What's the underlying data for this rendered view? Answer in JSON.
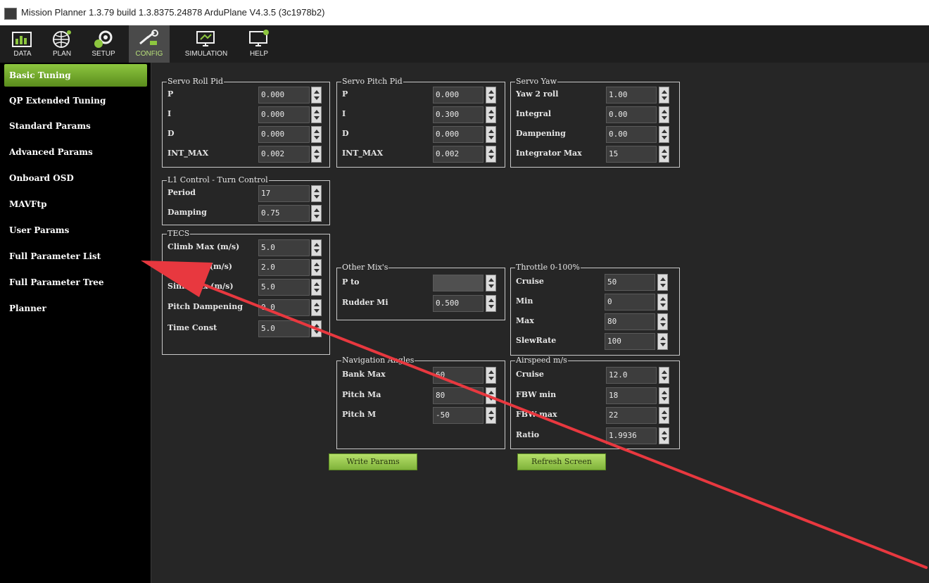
{
  "window": {
    "title": "Mission Planner 1.3.79 build 1.3.8375.24878 ArduPlane V4.3.5 (3c1978b2)"
  },
  "toolbar": [
    {
      "label": "DATA",
      "icon": "data-icon"
    },
    {
      "label": "PLAN",
      "icon": "plan-icon"
    },
    {
      "label": "SETUP",
      "icon": "setup-icon"
    },
    {
      "label": "CONFIG",
      "icon": "config-icon",
      "active": true
    },
    {
      "label": "SIMULATION",
      "icon": "simulation-icon"
    },
    {
      "label": "HELP",
      "icon": "help-icon"
    }
  ],
  "sidebar": [
    {
      "label": "Basic Tuning",
      "active": true
    },
    {
      "label": "QP Extended Tuning"
    },
    {
      "label": "Standard Params"
    },
    {
      "label": "Advanced Params"
    },
    {
      "label": "Onboard OSD"
    },
    {
      "label": "MAVFtp"
    },
    {
      "label": "User Params"
    },
    {
      "label": "Full Parameter List"
    },
    {
      "label": "Full Parameter Tree"
    },
    {
      "label": "Planner"
    }
  ],
  "groups": {
    "servo_roll": {
      "title": "Servo Roll Pid",
      "rows": [
        {
          "label": "P",
          "value": "0.000"
        },
        {
          "label": "I",
          "value": "0.000"
        },
        {
          "label": "D",
          "value": "0.000"
        },
        {
          "label": "INT_MAX",
          "value": "0.002"
        }
      ]
    },
    "servo_pitch": {
      "title": "Servo Pitch Pid",
      "rows": [
        {
          "label": "P",
          "value": "0.000"
        },
        {
          "label": "I",
          "value": "0.300"
        },
        {
          "label": "D",
          "value": "0.000"
        },
        {
          "label": "INT_MAX",
          "value": "0.002"
        }
      ]
    },
    "servo_yaw": {
      "title": "Servo Yaw",
      "rows": [
        {
          "label": "Yaw 2 roll",
          "value": "1.00"
        },
        {
          "label": "Integral",
          "value": "0.00"
        },
        {
          "label": "Dampening",
          "value": "0.00"
        },
        {
          "label": "Integrator Max",
          "value": "15"
        }
      ]
    },
    "l1": {
      "title": "L1 Control - Turn Control",
      "rows": [
        {
          "label": "Period",
          "value": "17"
        },
        {
          "label": "Damping",
          "value": "0.75"
        }
      ]
    },
    "tecs": {
      "title": "TECS",
      "rows": [
        {
          "label": "Climb Max (m/s)",
          "value": "5.0"
        },
        {
          "label": "Sink Min (m/s)",
          "value": "2.0"
        },
        {
          "label": "Sink Max (m/s)",
          "value": "5.0"
        },
        {
          "label": "Pitch Dampening",
          "value": "0.0"
        },
        {
          "label": "Time Const",
          "value": "5.0"
        }
      ]
    },
    "other_mix": {
      "title": "Other Mix's",
      "rows": [
        {
          "label": "P to",
          "value": ""
        },
        {
          "label": "Rudder Mi",
          "value": "0.500"
        }
      ]
    },
    "throttle": {
      "title": "Throttle 0-100%",
      "rows": [
        {
          "label": "Cruise",
          "value": "50"
        },
        {
          "label": "Min",
          "value": "0"
        },
        {
          "label": "Max",
          "value": "80"
        },
        {
          "label": "SlewRate",
          "value": "100"
        }
      ]
    },
    "nav_angles": {
      "title": "Navigation Angles",
      "rows": [
        {
          "label": "Bank Max",
          "value": "60"
        },
        {
          "label": "Pitch Ma",
          "value": "80"
        },
        {
          "label": "Pitch M",
          "value": "-50"
        }
      ]
    },
    "airspeed": {
      "title": "Airspeed m/s",
      "rows": [
        {
          "label": "Cruise",
          "value": "12.0"
        },
        {
          "label": "FBW min",
          "value": "18"
        },
        {
          "label": "FBW max",
          "value": "22"
        },
        {
          "label": "Ratio",
          "value": "1.9936"
        }
      ]
    }
  },
  "buttons": {
    "write": "Write Params",
    "refresh": "Refresh Screen"
  },
  "annotation": {
    "color": "#e8383f"
  },
  "colors": {
    "background": "#262626",
    "sidebar": "#000000",
    "accent": "#7fb23a"
  }
}
